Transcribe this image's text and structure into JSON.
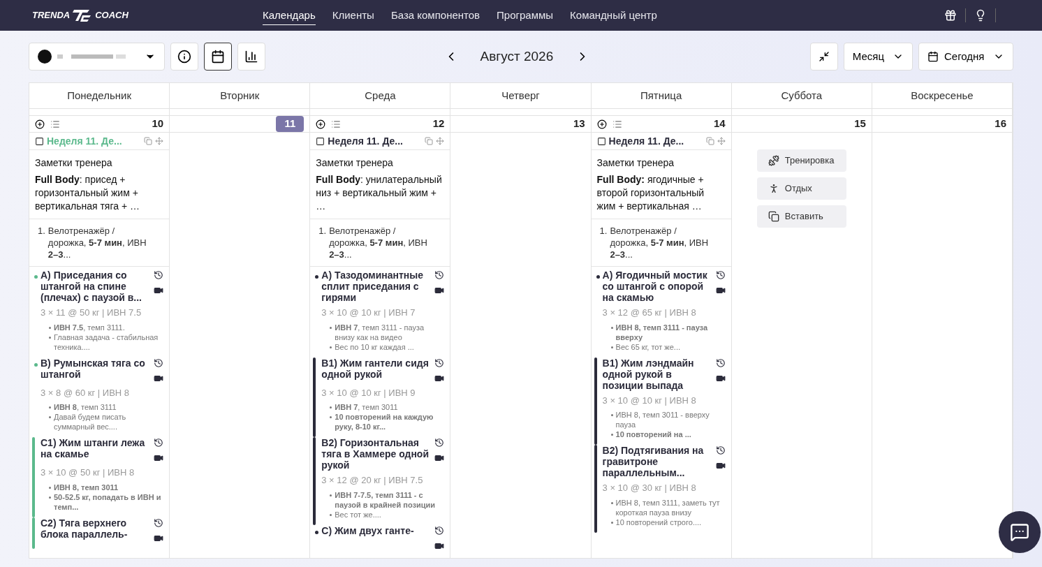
{
  "nav": {
    "logo_left": "TRENDA",
    "logo_right": "COACH",
    "items": [
      {
        "label": "Календарь",
        "selected": true
      },
      {
        "label": "Клиенты",
        "selected": false
      },
      {
        "label": "База компонентов",
        "selected": false
      },
      {
        "label": "Программы",
        "selected": false
      },
      {
        "label": "Командный центр",
        "selected": false
      }
    ]
  },
  "toolbar": {
    "views": [
      {
        "kind": "info",
        "selected": false
      },
      {
        "kind": "calendar",
        "selected": true
      },
      {
        "kind": "chart",
        "selected": false
      }
    ],
    "month": "Август 2026",
    "range": "Месяц",
    "today": "Сегодня"
  },
  "weekdays": [
    "Понедельник",
    "Вторник",
    "Среда",
    "Четверг",
    "Пятница",
    "Суббота",
    "Воскресенье"
  ],
  "days": [
    {
      "number": "10",
      "selected": false,
      "workout": {
        "checked": false,
        "title": "Неделя 11. Де...",
        "color": "#5bb98c",
        "notes_title": "Заметки тренера",
        "notes": "**Full Body**: присед + горизонтальный жим + вертикальная тяга + …",
        "warmup": [
          {
            "number": "1.",
            "text": "Велотренажёр / дорожка, **5-7 мин**, ИВН **2–3**..."
          }
        ],
        "exercises": [
          {
            "label": "A)",
            "name": "Приседания со штангой на спине (плечах) с паузой в...",
            "sets": "3 × 11 @ 50 кг | ИВН 7.5",
            "kind": "dot",
            "color": "#5bb98c",
            "notes": [
              "**ИВН 7.5**, темп 3111.",
              "Главная задача - стабильная техника...."
            ]
          },
          {
            "label": "B)",
            "name": "Румынская тяга со штангой",
            "sets": "3 × 8 @ 60 кг | ИВН 8",
            "kind": "dot",
            "color": "#5bb98c",
            "notes": [
              "**ИВН 8**, темп 3111",
              "Давай будем писать суммарный вес...."
            ]
          },
          {
            "label": "C1)",
            "name": "Жим штанги лежа на скамье",
            "sets": "3 × 10 @ 50 кг | ИВН 8",
            "kind": "bar",
            "color": "#5bb98c",
            "notes": [
              "**ИВН 8, темп 3011**",
              "**50-52.5 кг, попадать в ИВН и темп...**"
            ]
          },
          {
            "label": "C2)",
            "name": "Тяга верхнего блока параллель-",
            "kind": "bar",
            "color": "#5bb98c"
          }
        ]
      }
    },
    {
      "number": "11",
      "selected": true
    },
    {
      "number": "12",
      "selected": false,
      "workout": {
        "checked": false,
        "title": "Неделя 11. Де...",
        "color": "#2b2b3a",
        "notes_title": "Заметки тренера",
        "notes": "**Full Body**: унилатеральный низ + вертикальный жим + …",
        "warmup": [
          {
            "number": "1.",
            "text": "Велотренажёр / дорожка, **5-7 мин**, ИВН **2–3**..."
          }
        ],
        "exercises": [
          {
            "label": "A)",
            "name": "Тазодоминантные сплит приседания с гирями",
            "sets": "3 × 10 @ 10 кг | ИВН 7",
            "kind": "dot",
            "color": "#2b2b3a",
            "notes": [
              "**ИВН 7**, темп 3111 - пауза внизу как на видео",
              "Вес по 10 кг каждая ..."
            ]
          },
          {
            "label": "B1)",
            "name": "Жим гантели сидя одной рукой",
            "sets": "3 × 10 @ 10 кг | ИВН 9",
            "kind": "bar",
            "color": "#2b2b3a",
            "notes": [
              "**ИВН 7**, темп 3011",
              "**10 повторений на каждую руку, 8-10 кг...**"
            ]
          },
          {
            "label": "B2)",
            "name": "Горизонтальная тяга в Хаммере одной рукой",
            "sets": "3 × 12 @ 20 кг | ИВН 7.5",
            "kind": "bar",
            "color": "#2b2b3a",
            "notes": [
              "**ИВН 7-7.5, темп 3111 - с паузой в крайней позиции**",
              "Вес тот же...."
            ]
          },
          {
            "label": "C)",
            "name": "Жим двух ганте-",
            "kind": "dot",
            "color": "#2b2b3a"
          }
        ]
      }
    },
    {
      "number": "13",
      "selected": false
    },
    {
      "number": "14",
      "selected": false,
      "workout": {
        "checked": false,
        "title": "Неделя 11. Де...",
        "color": "#2b2b3a",
        "notes_title": "Заметки тренера",
        "notes": "**Full Body:** ягодичные + второй горизонтальный жим + вертикальная …",
        "warmup": [
          {
            "number": "1.",
            "text": "Велотренажёр / дорожка, **5-7 мин**, ИВН **2–3**..."
          }
        ],
        "exercises": [
          {
            "label": "A)",
            "name": "Ягодичный мостик со штангой с опорой на скамью",
            "sets": "3 × 12 @ 65 кг | ИВН 8",
            "kind": "dot",
            "color": "#2b2b3a",
            "notes": [
              "**ИВН 8, темп 3111 - пауза вверху**",
              "Вес 65 кг, тот же..."
            ]
          },
          {
            "label": "B1)",
            "name": "Жим лэндмайн одной рукой в позиции выпада",
            "sets": "3 × 10 @ 10 кг | ИВН 8",
            "kind": "bar",
            "color": "#2b2b3a",
            "notes": [
              "ИВН 8, темп 3011 - вверху пауза",
              "**10 повторений на ...**"
            ]
          },
          {
            "label": "B2)",
            "name": "Подтягивания на гравитроне параллельным...",
            "sets": "3 × 10 @ 30 кг | ИВН 8",
            "kind": "bar",
            "color": "#2b2b3a",
            "notes": [
              "ИВН 8, темп 3111, заметь тут короткая пауза внизу",
              "10 повторений строго...."
            ]
          }
        ]
      }
    },
    {
      "number": "15",
      "selected": false,
      "actions": [
        {
          "kind": "workout",
          "label": "Тренировка"
        },
        {
          "kind": "rest",
          "label": "Отдых"
        },
        {
          "kind": "paste",
          "label": "Вставить"
        }
      ]
    },
    {
      "number": "16",
      "selected": false
    }
  ]
}
